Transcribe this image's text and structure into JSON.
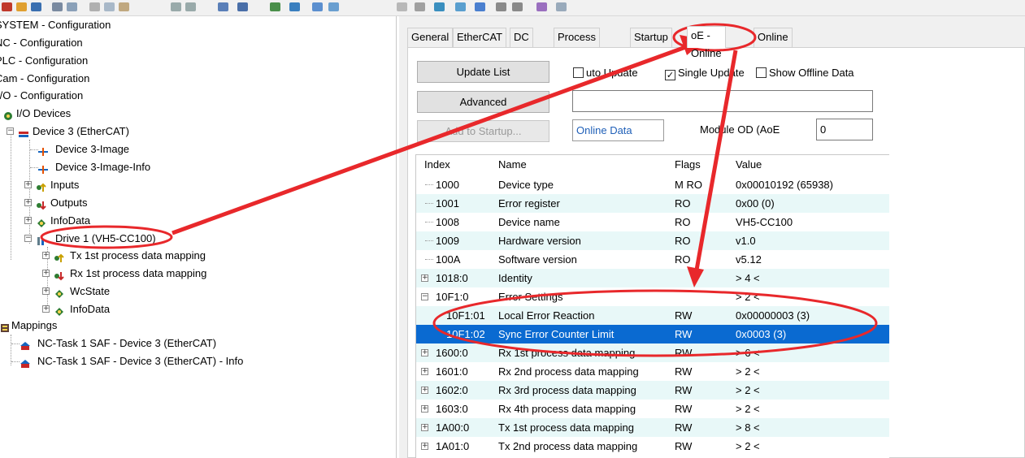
{
  "tree": {
    "items": [
      {
        "label": "SYSTEM - Configuration",
        "icon": "system-icon"
      },
      {
        "label": "NC - Configuration",
        "icon": "nc-icon"
      },
      {
        "label": "PLC - Configuration",
        "icon": "plc-icon"
      },
      {
        "label": "Cam - Configuration",
        "icon": "cam-icon"
      },
      {
        "label": "I/O - Configuration",
        "icon": "io-icon"
      },
      {
        "label": "I/O Devices",
        "icon": "io-devices-icon"
      },
      {
        "label": "Device 3 (EtherCAT)",
        "icon": "ethercat-device-icon"
      },
      {
        "label": "Device 3-Image",
        "icon": "image-icon"
      },
      {
        "label": "Device 3-Image-Info",
        "icon": "image-info-icon"
      },
      {
        "label": "Inputs",
        "icon": "inputs-icon"
      },
      {
        "label": "Outputs",
        "icon": "outputs-icon"
      },
      {
        "label": "InfoData",
        "icon": "infodata-icon"
      },
      {
        "label": "Drive 1 (VH5-CC100)",
        "icon": "drive-icon"
      },
      {
        "label": "Tx 1st  process data mapping",
        "icon": "tx-mapping-icon"
      },
      {
        "label": "Rx 1st process data mapping",
        "icon": "rx-mapping-icon"
      },
      {
        "label": "WcState",
        "icon": "wcstate-icon"
      },
      {
        "label": "InfoData",
        "icon": "infodata-icon"
      },
      {
        "label": "Mappings",
        "icon": "mappings-icon"
      },
      {
        "label": "NC-Task 1 SAF - Device 3 (EtherCAT)",
        "icon": "task-mapping-icon"
      },
      {
        "label": "NC-Task 1 SAF - Device 3 (EtherCAT) - Info",
        "icon": "task-mapping-icon"
      }
    ]
  },
  "tabs": [
    "General",
    "EtherCAT",
    "DC",
    "Process Data",
    "Startup",
    "CoE - Online",
    "Online"
  ],
  "tabs_visible": {
    "coe_partial": "oE - Online",
    "startup_partial": "Startup"
  },
  "controls": {
    "update_list": "Update List",
    "advanced": "Advanced",
    "add_to_startup": "Add to Startup...",
    "auto_update": "Auto Update",
    "auto_update_visible": "uto Update",
    "single_update": "Single Update",
    "show_offline": "Show Offline Data",
    "online_data": "Online Data",
    "module_od": "Module OD (AoE",
    "module_od_value": "0",
    "search_value": "",
    "checkmark": "✓"
  },
  "table": {
    "headers": {
      "index": "Index",
      "name": "Name",
      "flags": "Flags",
      "value": "Value"
    },
    "rows": [
      {
        "index": "1000",
        "name": "Device type",
        "flags": "M RO",
        "value": "0x00010192 (65938)",
        "exp": ""
      },
      {
        "index": "1001",
        "name": "Error register",
        "flags": "RO",
        "value": "0x00 (0)",
        "exp": ""
      },
      {
        "index": "1008",
        "name": "Device name",
        "flags": "RO",
        "value": "VH5-CC100",
        "exp": ""
      },
      {
        "index": "1009",
        "name": "Hardware version",
        "flags": "RO",
        "value": "v1.0",
        "exp": ""
      },
      {
        "index": "100A",
        "name": "Software version",
        "flags": "RO",
        "value": "v5.12",
        "exp": ""
      },
      {
        "index": "1018:0",
        "name": "Identity",
        "flags": "",
        "value": "> 4 <",
        "exp": "+"
      },
      {
        "index": "10F1:0",
        "name": "Error Settings",
        "flags": "",
        "value": "> 2 <",
        "exp": "−"
      },
      {
        "index": "10F1:01",
        "name": "Local Error Reaction",
        "flags": "RW",
        "value": "0x00000003 (3)",
        "exp": ""
      },
      {
        "index": "10F1:02",
        "name": "Sync Error Counter Limit",
        "flags": "RW",
        "value": "0x0003 (3)",
        "exp": ""
      },
      {
        "index": "1600:0",
        "name": "Rx 1st process data mapping",
        "flags": "RW",
        "value": "> 6 <",
        "exp": "+"
      },
      {
        "index": "1601:0",
        "name": "Rx 2nd process data mapping",
        "flags": "RW",
        "value": "> 2 <",
        "exp": "+"
      },
      {
        "index": "1602:0",
        "name": "Rx 3rd process data mapping",
        "flags": "RW",
        "value": "> 2 <",
        "exp": "+"
      },
      {
        "index": "1603:0",
        "name": "Rx 4th process data mapping",
        "flags": "RW",
        "value": "> 2 <",
        "exp": "+"
      },
      {
        "index": "1A00:0",
        "name": "Tx 1st  process data mapping",
        "flags": "RW",
        "value": "> 8 <",
        "exp": "+"
      },
      {
        "index": "1A01:0",
        "name": "Tx 2nd process data mapping",
        "flags": "RW",
        "value": "> 2 <",
        "exp": "+"
      }
    ]
  },
  "colors": {
    "selection": "#0a6ad1",
    "annotation": "#e8282b",
    "row_alt": "#e8f8f8"
  }
}
